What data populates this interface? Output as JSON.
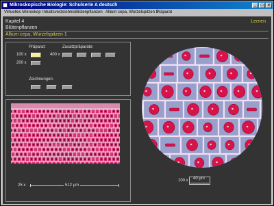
{
  "window": {
    "title": "Mikroskopische Biologie: Schulserie A deutsch",
    "minimize_glyph": "_",
    "maximize_glyph": "□",
    "close_glyph": "×"
  },
  "menu": [
    "Virtuelles Mikroskop",
    "Inhaltsverzeichnis",
    "Blütenpflanzen",
    "Allium cepa, Wurzelspitzen 1",
    "Präparat"
  ],
  "header": {
    "chapter": "Kapitel 4",
    "subchapter": "Blütenpflanzen",
    "mode": "Lernen"
  },
  "topic": "Allium cepa, Wurzelspitzen 1",
  "controls": {
    "praeparat_label": "Präparat:",
    "zusatz_label": "Zusatzpräparate:",
    "zeichnungen_label": "Zeichnungen:",
    "mag_100": "100 x",
    "mag_200": "200 x",
    "mag_400": "400 x",
    "selected_magnification": "100 x"
  },
  "overview": {
    "magnification": "25 x",
    "scale": "512 µm"
  },
  "main_view": {
    "magnification": "100 x",
    "scale": "40 µm"
  },
  "colors": {
    "content_bg": "#333333",
    "accent_text": "#d7c84c",
    "selected_button": "#f4eea2",
    "cell_wall": "#e8d8f0",
    "cytoplasm": "#9aa0cc",
    "nucleus": "#d8134a"
  }
}
